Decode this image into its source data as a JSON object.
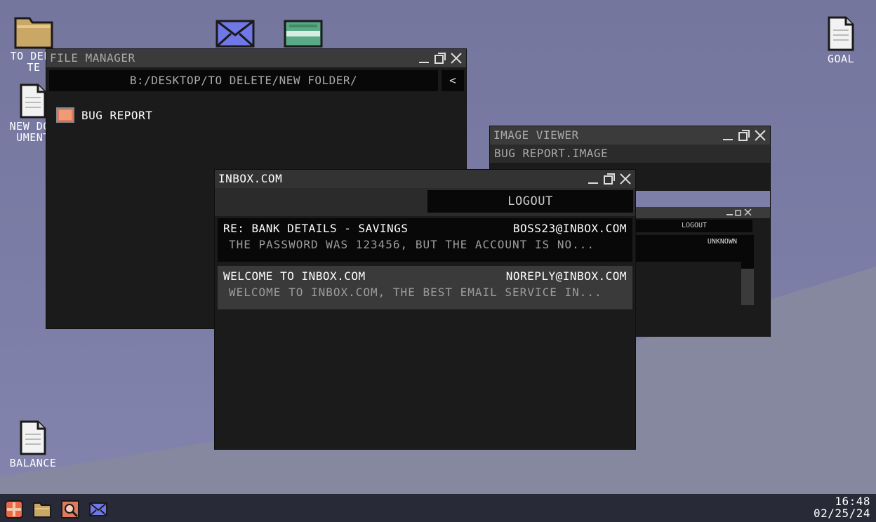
{
  "desktop": {
    "icons": {
      "to_delete": "TO DELETE",
      "new_document": "NEW DOCUMENT",
      "goal": "GOAL",
      "balance": "BALANCE"
    }
  },
  "file_manager": {
    "title": "FILE MANAGER",
    "path": "B:/DESKTOP/TO DELETE/NEW FOLDER/",
    "back_label": "<",
    "items": [
      {
        "name": "BUG REPORT",
        "icon": "image-file-icon"
      }
    ]
  },
  "image_viewer": {
    "title": "IMAGE VIEWER",
    "filename": "BUG REPORT.IMAGE",
    "screenshot": {
      "logout_label": "LOGOUT",
      "sender": "UNKNOWN"
    }
  },
  "inbox": {
    "title": "INBOX.COM",
    "logout_label": "LOGOUT",
    "emails": [
      {
        "subject": "RE: BANK DETAILS - SAVINGS",
        "from": "BOSS23@INBOX.COM",
        "preview": "THE PASSWORD WAS 123456, BUT THE ACCOUNT IS NO..."
      },
      {
        "subject": "WELCOME TO INBOX.COM",
        "from": "NOREPLY@INBOX.COM",
        "preview": "WELCOME TO INBOX.COM, THE BEST EMAIL SERVICE IN..."
      }
    ]
  },
  "taskbar": {
    "apps": [
      "start-icon",
      "file-manager-icon",
      "image-viewer-icon",
      "mail-icon"
    ],
    "time": "16:48",
    "date": "02/25/24"
  },
  "colors": {
    "desktop": "#7a7ca6",
    "window": "#1b1b1b",
    "titlebar": "#3b3b3b",
    "taskbar": "#292a37",
    "accent": "#6d6fd8"
  }
}
